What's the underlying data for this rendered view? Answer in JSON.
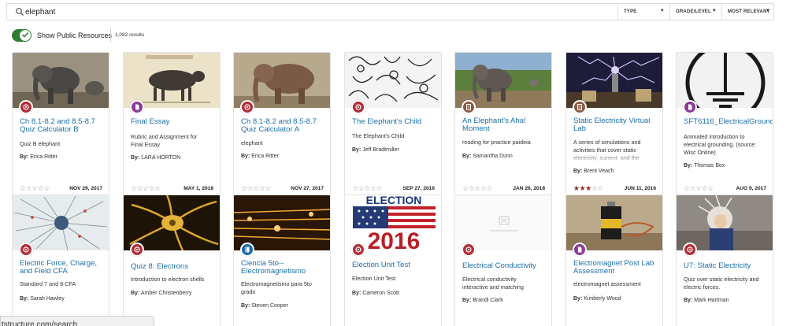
{
  "search": {
    "query": "elephant"
  },
  "filters": {
    "type": "TYPE",
    "grade": "GRADE/LEVEL",
    "sort": "MOST RELEVANT"
  },
  "toolbar": {
    "toggle_label": "Show Public Resources",
    "toggle_on": true,
    "results": "1,082 results"
  },
  "colors": {
    "title_link": "#1a6fa8",
    "toggle_on": "#2e7d32",
    "badge_red": "#b0303b",
    "badge_purple": "#8e3a96",
    "badge_brown": "#8a5a44",
    "badge_blue": "#1b6aa8",
    "star_filled": "#8b2e22"
  },
  "cards": [
    {
      "title": "Ch 8.1-8.2 and 8.5-8.7\nQuiz Calculator B",
      "desc": "Quiz B elephant",
      "author": "Erica Ritter",
      "date": "NOV 29, 2017",
      "rating": 0,
      "badge": "quiz-icon"
    },
    {
      "title": "Final Essay",
      "desc": "Rubric and Assignment for\nFinal Essay",
      "author": "LARA HORTON",
      "date": "MAY 1, 2018",
      "rating": 0,
      "badge": "document-icon"
    },
    {
      "title": "Ch 8.1-8.2 and 8.5-8.7\nQuiz Calculator A",
      "desc": "elephant",
      "author": "Erica Ritter",
      "date": "NOV 27, 2017",
      "rating": 0,
      "badge": "quiz-icon"
    },
    {
      "title": "The Elephant's Child",
      "desc": "The Elephant's Child",
      "author": "Jeff Bradtmiller",
      "date": "SEP 27, 2016",
      "rating": 0,
      "badge": "quiz-icon"
    },
    {
      "title": "An Elephant's Aha!\nMoment",
      "desc": "reading for practice paideia",
      "author": "Samantha Dunn",
      "date": "JAN 26, 2018",
      "rating": 0,
      "badge": "page-icon"
    },
    {
      "title": "Static Electricity Virtual\nLab",
      "desc": "A series of simulations and\nactivities that cover static\nelectricity, current, and the",
      "author": "Brent Veach",
      "date": "JUN 11, 2016",
      "rating": 3,
      "badge": "page-icon"
    },
    {
      "title": "SFT6116_ElectricalGrounding",
      "desc": "Animated introduction to\nelectrical grounding. (source:\nWisc Online)",
      "author": "Thomas Box",
      "date": "AUG 9, 2017",
      "rating": 0,
      "badge": "document-icon"
    },
    {
      "title": "Electric Force, Charge,\nand Field CFA",
      "desc": "Standard 7 and 8 CFA",
      "author": "Sarah Hawley",
      "badge": "quiz-icon"
    },
    {
      "title": "Quiz 8: Electrons",
      "desc": "Introduction to electron shells",
      "author": "Amber Christenberry",
      "badge": "quiz-icon"
    },
    {
      "title": "Ciencia 5to--\nElectromagnetismo",
      "desc": "Electromagnetismo para 5to\ngrado",
      "author": "Steven Cooper",
      "badge": "book-icon"
    },
    {
      "title": "Election Unit Test",
      "desc": "Election Unit Test",
      "author": "Cameron Scott",
      "badge": "quiz-icon",
      "thumb_text_top": "ELECTION",
      "thumb_text_bottom": "2016"
    },
    {
      "title": "Electrical Conductivity",
      "desc": "Electrical conductivity\ninteractive and matching",
      "author": "Brandi Clark",
      "badge": "quiz-icon"
    },
    {
      "title": "Electromagnet Post Lab\nAssessment",
      "desc": "electromagnet assessment",
      "author": "Kimberly Wood",
      "badge": "document-icon"
    },
    {
      "title": "U7: Static Electricity",
      "desc": "Quiz over static electricity and\nelectric forces.",
      "author": "Mark Hartman",
      "badge": "quiz-icon"
    }
  ],
  "byline_label": "By:",
  "statusbar": {
    "url": "tstructure.com/search"
  }
}
